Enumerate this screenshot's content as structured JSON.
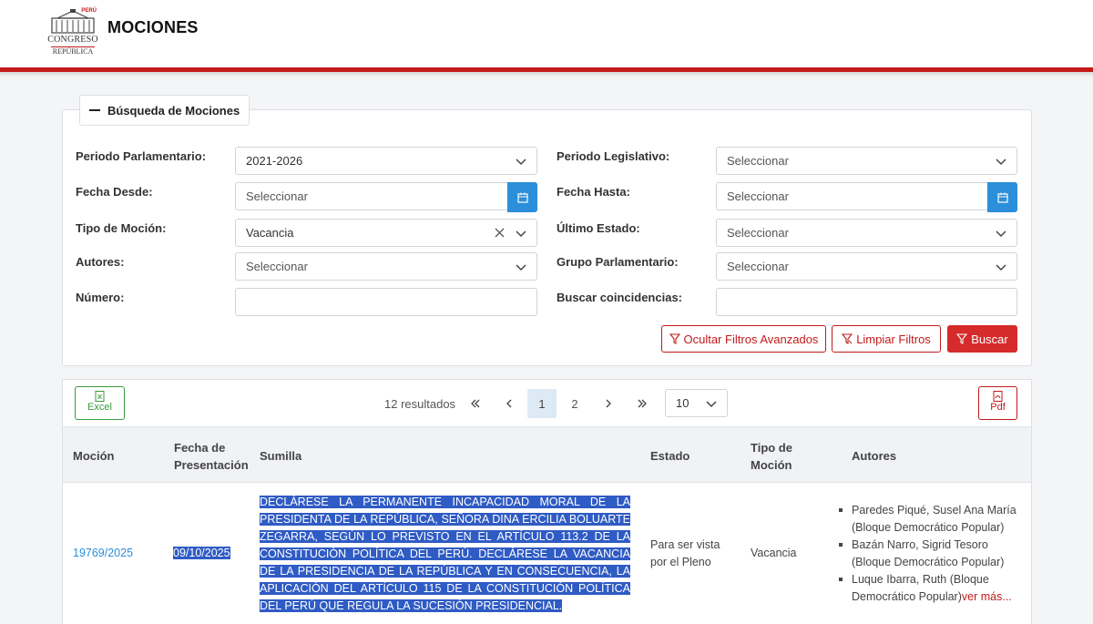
{
  "header": {
    "title": "MOCIONES",
    "logo": {
      "top": "PERÚ",
      "name": "CONGRESO",
      "sub": "REPÚBLICA"
    },
    "accent_color": "#c21a1a"
  },
  "search": {
    "legend": "Búsqueda de Mociones",
    "periodo_parlamentario": {
      "label": "Periodo Parlamentario:",
      "value": "2021-2026"
    },
    "periodo_legislativo": {
      "label": "Periodo Legislativo:",
      "placeholder": "Seleccionar"
    },
    "fecha_desde": {
      "label": "Fecha Desde:",
      "placeholder": "Seleccionar"
    },
    "fecha_hasta": {
      "label": "Fecha Hasta:",
      "placeholder": "Seleccionar"
    },
    "tipo_mocion": {
      "label": "Tipo de Moción:",
      "value": "Vacancia"
    },
    "ultimo_estado": {
      "label": "Último Estado:",
      "placeholder": "Seleccionar"
    },
    "autores": {
      "label": "Autores:",
      "placeholder": "Seleccionar"
    },
    "grupo_parlamentario": {
      "label": "Grupo Parlamentario:",
      "placeholder": "Seleccionar"
    },
    "numero": {
      "label": "Número:",
      "value": ""
    },
    "buscar_coincidencias": {
      "label": "Buscar coincidencias:",
      "value": ""
    },
    "buttons": {
      "ocultar": "Ocultar Filtros Avanzados",
      "limpiar": "Limpiar Filtros",
      "buscar": "Buscar"
    }
  },
  "results": {
    "excel_label": "Excel",
    "pdf_label": "Pdf",
    "count_text": "12 resultados",
    "pages": [
      "1",
      "2"
    ],
    "current_page": "1",
    "per_page": "10",
    "columns": [
      "Moción",
      "Fecha de Presentación",
      "Sumilla",
      "Estado",
      "Tipo de Moción",
      "Autores"
    ],
    "columns_split": {
      "fecha": [
        "Fecha de",
        "Presentación"
      ],
      "tipo": [
        "Tipo de",
        "Moción"
      ]
    },
    "rows": [
      {
        "mocion": "19769/2025",
        "fecha": "09/10/2025",
        "sumilla": "DECLÁRESE LA PERMANENTE INCAPACIDAD MORAL DE LA PRESIDENTA DE LA REPÚBLICA, SEÑORA DINA ERCILIA BOLUARTE ZEGARRA, SEGÚN LO PREVISTO EN EL ARTÍCULO 113.2 DE LA CONSTITUCIÓN POLÍTICA DEL PERÚ. DECLÁRESE LA VACANCIA DE LA PRESIDENCIA DE LA REPÚBLICA Y EN CONSECUENCIA, LA APLICACIÓN DEL ARTÍCULO 115 DE LA CONSTITUCIÓN POLÍTICA DEL PERÚ QUE REGULA LA SUCESIÓN PRESIDENCIAL.",
        "estado_lines": [
          "Para ser vista",
          "por el Pleno"
        ],
        "tipo": "Vacancia",
        "autores": [
          "Paredes Piqué, Susel Ana María (Bloque Democrático Popular)",
          "Bazán Narro, Sigrid Tesoro (Bloque Democrático Popular)",
          "Luque Ibarra, Ruth (Bloque Democrático Popular)"
        ],
        "ver_mas": "ver más..."
      }
    ]
  }
}
